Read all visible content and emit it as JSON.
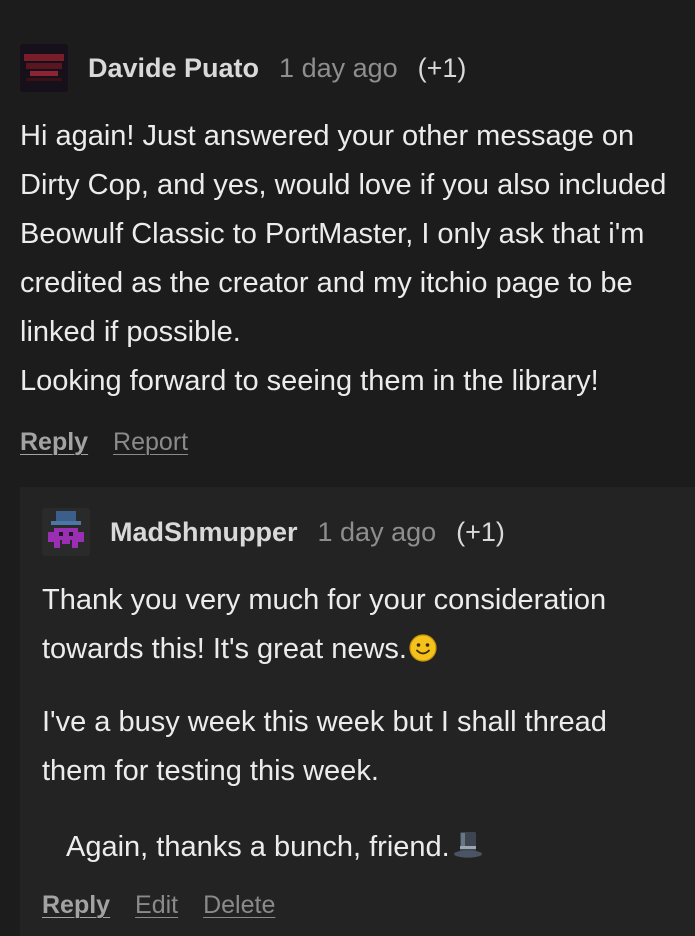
{
  "comments": [
    {
      "author": "Davide Puato",
      "time": "1 day ago",
      "votes": "(+1)",
      "lines": [
        "Hi again! Just answered your other message on",
        "Dirty Cop, and yes, would love if you also included",
        "Beowulf Classic to PortMaster, I only ask that i'm",
        "credited as the creator and my itchio page to be",
        "linked if possible.",
        "Looking forward to seeing them in the library!"
      ],
      "actions": {
        "reply": "Reply",
        "report": "Report"
      }
    },
    {
      "author": "MadShmupper",
      "time": "1 day ago",
      "votes": "(+1)",
      "para1": [
        "Thank you very much for your consideration",
        "towards this! It's great news."
      ],
      "para2": [
        "I've a busy week this week but I shall thread",
        "them for testing this week."
      ],
      "para3": "Again, thanks a bunch, friend.",
      "actions": {
        "reply": "Reply",
        "edit": "Edit",
        "delete": "Delete"
      }
    }
  ],
  "icons": {
    "smile": "smiling-face-emoji",
    "tophat": "top-hat-emoji"
  },
  "colors": {
    "background": "#1c1c1c",
    "reply_background": "#232323",
    "text": "#ececec",
    "muted": "#8e8e8e"
  }
}
